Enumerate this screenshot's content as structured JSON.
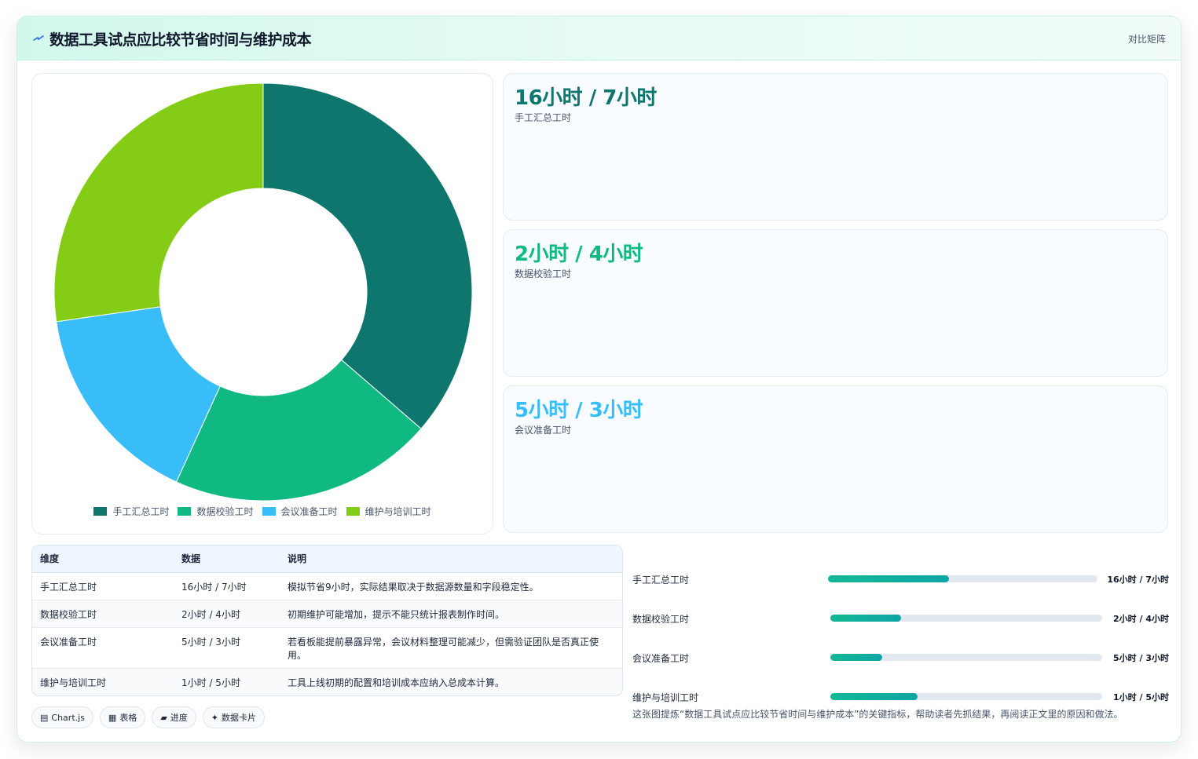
{
  "header": {
    "title": "数据工具试点应比较节省时间与维护成本",
    "tag": "对比矩阵",
    "logo_icon": "sparkle-icon"
  },
  "chart_data": {
    "type": "doughnut",
    "categories": [
      "手工汇总工时",
      "数据校验工时",
      "会议准备工时",
      "维护与培训工时"
    ],
    "values": [
      16,
      9,
      7,
      12
    ],
    "colors": [
      "#0f766e",
      "#10b981",
      "#38bdf8",
      "#84cc16"
    ],
    "legend_position": "bottom"
  },
  "stats": [
    {
      "value": "16小时 / 7小时",
      "label": "手工汇总工时",
      "color": "#0f766e"
    },
    {
      "value": "2小时 / 4小时",
      "label": "数据校验工时",
      "color": "#10b981"
    },
    {
      "value": "5小时 / 3小时",
      "label": "会议准备工时",
      "color": "#38bdf8"
    }
  ],
  "table": {
    "headers": [
      "维度",
      "数据",
      "说明"
    ],
    "rows": [
      [
        "手工汇总工时",
        "16小时 / 7小时",
        "模拟节省9小时，实际结果取决于数据源数量和字段稳定性。"
      ],
      [
        "数据校验工时",
        "2小时 / 4小时",
        "初期维护可能增加，提示不能只统计报表制作时间。"
      ],
      [
        "会议准备工时",
        "5小时 / 3小时",
        "若看板能提前暴露异常，会议材料整理可能减少，但需验证团队是否真正使用。"
      ],
      [
        "维护与培训工时",
        "1小时 / 5小时",
        "工具上线初期的配置和培训成本应纳入总成本计算。"
      ]
    ]
  },
  "chips": [
    {
      "icon": "chart-icon",
      "glyph": "▤",
      "label": "Chart.js"
    },
    {
      "icon": "table-icon",
      "glyph": "▦",
      "label": "表格"
    },
    {
      "icon": "progress-icon",
      "glyph": "▰",
      "label": "进度"
    },
    {
      "icon": "card-icon",
      "glyph": "✦",
      "label": "数据卡片"
    }
  ],
  "progress": [
    {
      "label": "手工汇总工时",
      "value": "16小时 / 7小时",
      "fraction": 0.45
    },
    {
      "label": "数据校验工时",
      "value": "2小时 / 4小时",
      "fraction": 0.26
    },
    {
      "label": "会议准备工时",
      "value": "5小时 / 3小时",
      "fraction": 0.19
    },
    {
      "label": "维护与培训工时",
      "value": "1小时 / 5小时",
      "fraction": 0.32
    }
  ],
  "note": "这张图提炼“数据工具试点应比较节省时间与维护成本”的关键指标，帮助读者先抓结果，再阅读正文里的原因和做法。"
}
